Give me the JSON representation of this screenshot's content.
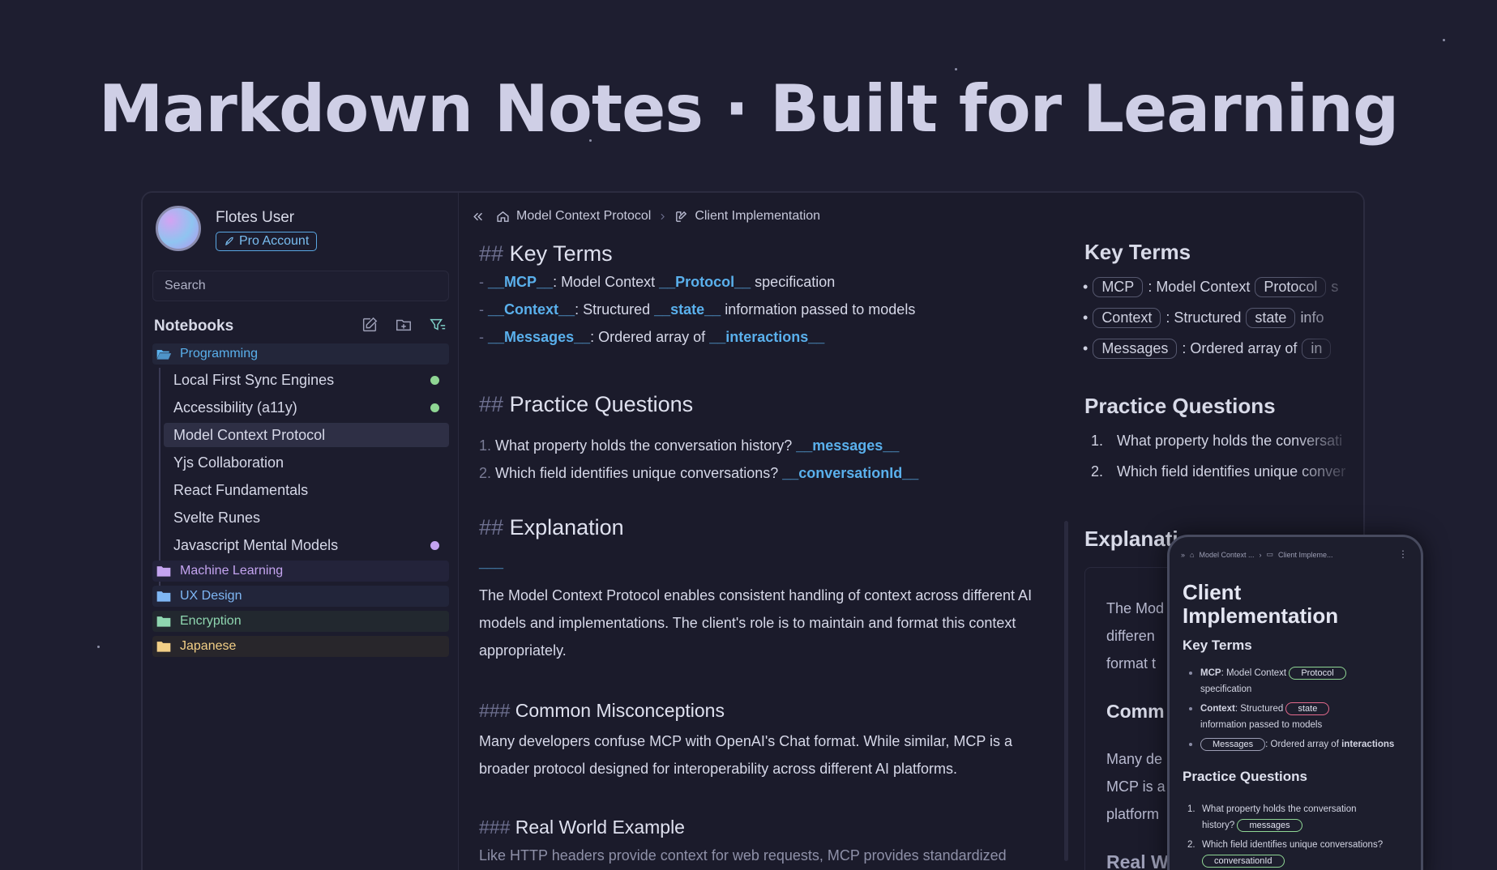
{
  "hero": {
    "title": "Markdown Notes · Built for Learning"
  },
  "colors": {
    "background": "#1e1e30",
    "accent": "#5ab0ec",
    "green": "#8fd694",
    "purple": "#c4a4f0"
  },
  "user": {
    "name": "Flotes User",
    "badge": "Pro Account"
  },
  "search": {
    "placeholder": "Search"
  },
  "notebooks": {
    "title": "Notebooks",
    "tools": [
      "new-note-icon",
      "new-folder-icon",
      "filter-icon"
    ],
    "folders": [
      {
        "label": "Programming",
        "color": "#5ab0ec"
      },
      {
        "label": "Machine Learning",
        "color": "#c4a4f0"
      },
      {
        "label": "UX Design",
        "color": "#7fb7f5"
      },
      {
        "label": "Encryption",
        "color": "#8fd6b0"
      },
      {
        "label": "Japanese",
        "color": "#f2cf86"
      }
    ],
    "notes": [
      {
        "label": "Local First Sync Engines",
        "dot": "#8fd694"
      },
      {
        "label": "Accessibility (a11y)",
        "dot": "#8fd694"
      },
      {
        "label": "Model Context Protocol",
        "dot": ""
      },
      {
        "label": "Yjs Collaboration",
        "dot": ""
      },
      {
        "label": "React Fundamentals",
        "dot": ""
      },
      {
        "label": "Svelte Runes",
        "dot": ""
      },
      {
        "label": "Javascript Mental Models",
        "dot": "#c4a4f0"
      }
    ]
  },
  "breadcrumb": {
    "parent": "Model Context Protocol",
    "current": "Client Implementation"
  },
  "editor": {
    "key_terms": {
      "hash": "##",
      "title": "Key Terms"
    },
    "terms": [
      {
        "dash": "-",
        "a": "__MCP__",
        "mid": ": Model Context ",
        "b": "__Protocol__",
        "end": " specification"
      },
      {
        "dash": "-",
        "a": "__Context__",
        "mid": ": Structured ",
        "b": "__state__",
        "end": " information passed to models"
      },
      {
        "dash": "-",
        "a": "__Messages__",
        "mid": ": Ordered array of ",
        "b": "__interactions__",
        "end": ""
      }
    ],
    "practice": {
      "hash": "##",
      "title": "Practice Questions"
    },
    "questions": [
      {
        "num": "1.",
        "text": "What property holds the conversation history? ",
        "answer": "__messages__"
      },
      {
        "num": "2.",
        "text": "Which field identifies unique conversations? ",
        "answer": "__conversationId__"
      }
    ],
    "explanation": {
      "hash": "##",
      "title": "Explanation",
      "blank": "___"
    },
    "explanation_text": "The Model Context Protocol enables consistent handling of context across different AI models and implementations. The client's role is to maintain and format this context appropriately.",
    "misconceptions": {
      "hash": "###",
      "title": "Common Misconceptions"
    },
    "misconceptions_text": "Many developers confuse MCP with OpenAI's Chat format. While similar, MCP is a broader protocol designed for interoperability across different AI platforms.",
    "example": {
      "hash": "###",
      "title": "Real World Example"
    },
    "example_text": "Like HTTP headers provide context for web requests, MCP provides standardized"
  },
  "preview": {
    "key_terms": "Key Terms",
    "terms": [
      {
        "a": "MCP",
        "mid": ": Model Context",
        "b": "Protocol",
        "end": "s"
      },
      {
        "a": "Context",
        "mid": ": Structured",
        "b": "state",
        "end": "info"
      },
      {
        "a": "Messages",
        "mid": ": Ordered array of",
        "b": "",
        "end": "in"
      }
    ],
    "practice": "Practice Questions",
    "questions": [
      {
        "num": "1.",
        "text": "What property holds the conversati"
      },
      {
        "num": "2.",
        "text": "Which field identifies unique conver"
      }
    ],
    "explanation": "Explanati",
    "card_lines": [
      "The Mod",
      "differen",
      "format t"
    ],
    "misconceptions": "Comm",
    "misc_lines": [
      "Many de",
      "MCP is a",
      "platform"
    ],
    "example": "Real W"
  },
  "phone": {
    "crumb_parent": "Model Context ...",
    "crumb_current": "Client Impleme...",
    "title_line1": "Client",
    "title_line2": "Implementation",
    "key_terms": "Key Terms",
    "t1_bold": "MCP",
    "t1_mid": ": Model Context",
    "t1_pill": "Protocol",
    "t1_wrap": "specification",
    "t2_bold": "Context",
    "t2_mid": ": Structured",
    "t2_pill": "state",
    "t2_wrap": "information passed to models",
    "t3_pill": "Messages",
    "t3_mid": ": Ordered array of",
    "t3_bold": "interactions",
    "practice": "Practice Questions",
    "q1_num": "1.",
    "q1_a": "What property holds the conversation",
    "q1_b": "history?",
    "q1_pill": "messages",
    "q2_num": "2.",
    "q2_a": "Which field identifies unique conversations?",
    "q2_pill": "conversationId"
  }
}
